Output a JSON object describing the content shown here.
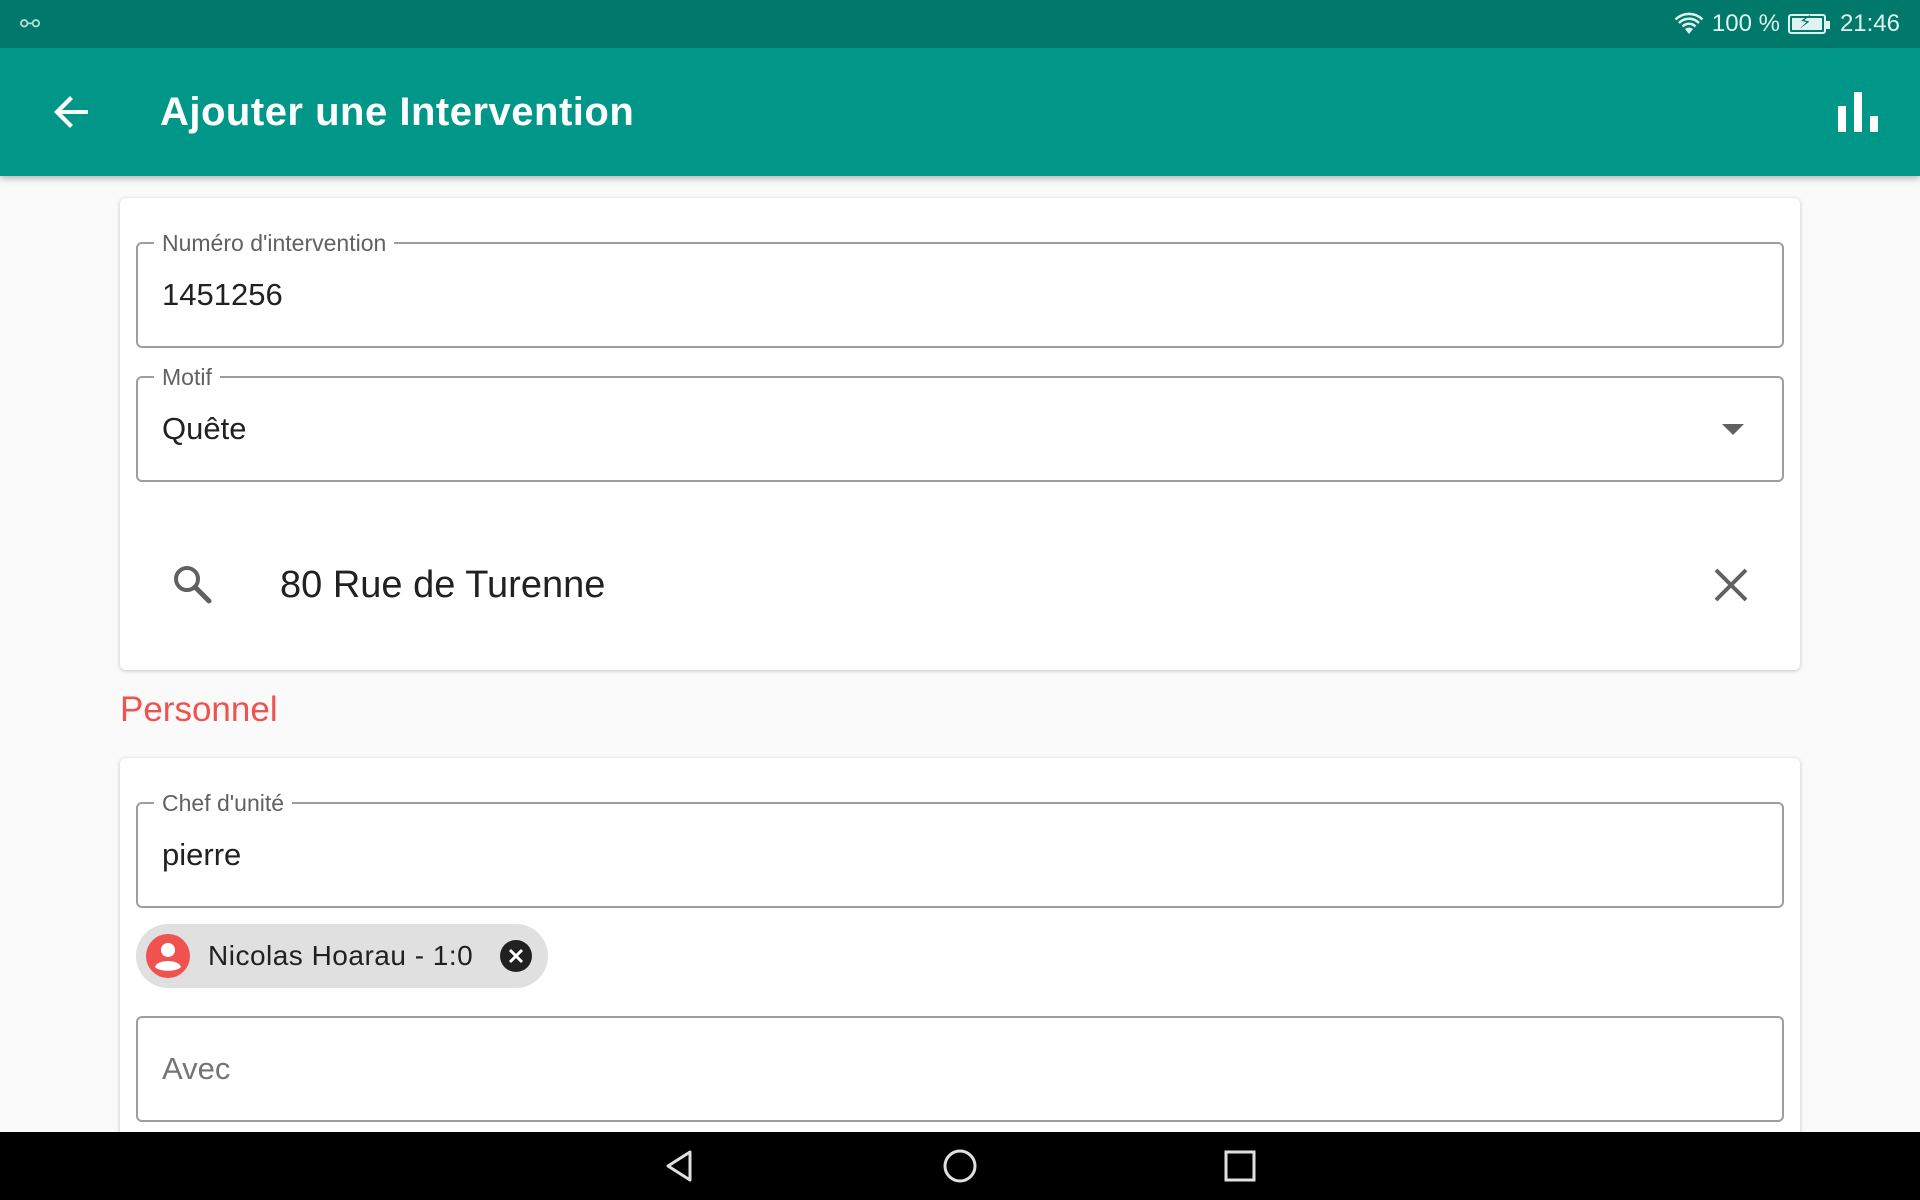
{
  "status_bar": {
    "usb_icon": "usb-icon",
    "wifi_icon": "wifi-icon",
    "battery_percent": "100 %",
    "battery_icon": "battery-charging-icon",
    "time": "21:46"
  },
  "app_bar": {
    "back_icon": "arrow-back-icon",
    "title": "Ajouter une Intervention",
    "stats_icon": "bar-chart-icon",
    "background": "#009688"
  },
  "intervention": {
    "numero": {
      "label": "Numéro d'intervention",
      "value": "1451256"
    },
    "motif": {
      "label": "Motif",
      "value": "Quête",
      "dropdown_icon": "arrow-drop-down-icon"
    },
    "address_search": {
      "value": "80 Rue de Turenne",
      "search_icon": "search-icon",
      "clear_icon": "close-icon"
    }
  },
  "personnel": {
    "section_title": "Personnel",
    "section_color": "#ef5350",
    "chef": {
      "label": "Chef d'unité",
      "value": "pierre"
    },
    "selected_chip": {
      "text": "Nicolas Hoarau - 1:0",
      "avatar_icon": "account-circle-icon",
      "remove_icon": "cancel-icon"
    },
    "avec": {
      "placeholder": "Avec"
    }
  },
  "nav_bar": {
    "back_icon": "nav-back-icon",
    "home_icon": "nav-home-icon",
    "recents_icon": "nav-recents-icon"
  }
}
